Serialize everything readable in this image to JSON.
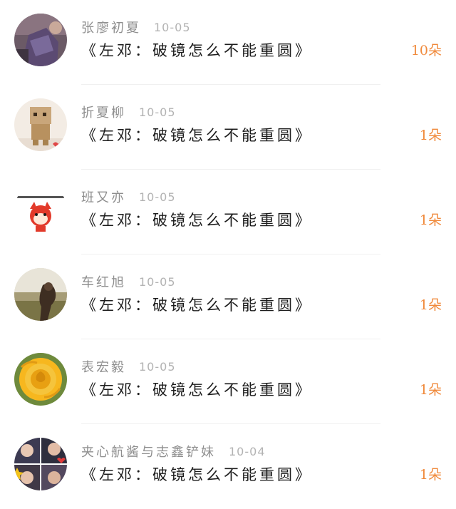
{
  "rows": [
    {
      "username": "张廖初夏",
      "date": "10-05",
      "title": "《左邓：破镜怎么不能重圆》",
      "count": "10朵",
      "avatar_icon": "photo-avatar-icon"
    },
    {
      "username": "折夏柳",
      "date": "10-05",
      "title": "《左邓：破镜怎么不能重圆》",
      "count": "1朵",
      "avatar_icon": "danbo-avatar-icon"
    },
    {
      "username": "班又亦",
      "date": "10-05",
      "title": "《左邓：破镜怎么不能重圆》",
      "count": "1朵",
      "avatar_icon": "cartoon-fox-avatar-icon"
    },
    {
      "username": "车红旭",
      "date": "10-05",
      "title": "《左邓：破镜怎么不能重圆》",
      "count": "1朵",
      "avatar_icon": "landscape-avatar-icon"
    },
    {
      "username": "表宏毅",
      "date": "10-05",
      "title": "《左邓：破镜怎么不能重圆》",
      "count": "1朵",
      "avatar_icon": "yellow-rose-avatar-icon"
    },
    {
      "username": "夹心航酱与志鑫铲妹",
      "date": "10-04",
      "title": "《左邓：破镜怎么不能重圆》",
      "count": "1朵",
      "avatar_icon": "collage-avatar-icon"
    }
  ],
  "colors": {
    "username": "#8e8e8e",
    "date": "#b3b3b3",
    "title": "#1c1c1c",
    "count": "#f08a3c",
    "divider": "#f0f0f0"
  }
}
